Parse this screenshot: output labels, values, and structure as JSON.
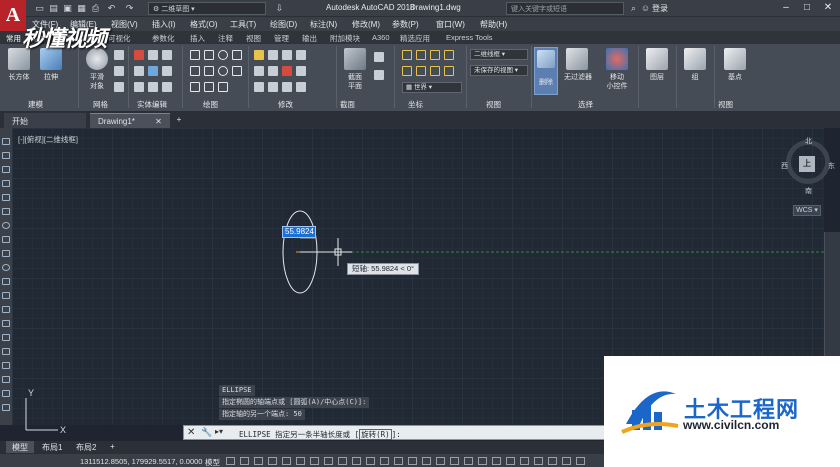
{
  "titlebar": {
    "workspace": "二维草图",
    "app_title": "Autodesk AutoCAD 2018",
    "file_name": "Drawing1.dwg",
    "search_placeholder": "键入关键字或短语",
    "login": "登录"
  },
  "menubar": {
    "items": [
      "文件(F)",
      "编辑(E)",
      "视图(V)",
      "插入(I)",
      "格式(O)",
      "工具(T)",
      "绘图(D)",
      "标注(N)",
      "修改(M)",
      "参数(P)",
      "窗口(W)",
      "帮助(H)",
      "Express"
    ]
  },
  "ribbon_tabs": [
    "常用",
    "实体",
    "曲面",
    "网格",
    "可视化",
    "参数化",
    "插入",
    "注释",
    "视图",
    "管理",
    "输出",
    "附加模块",
    "A360",
    "精选应用",
    "Express Tools"
  ],
  "ribbon": {
    "btn_box": "长方体",
    "btn_extrude": "拉伸",
    "btn_smooth": "平滑\n对象",
    "btn_section_plane": "截面\n平面",
    "btn_delete": "删除",
    "btn_no_filter": "无过滤器",
    "btn_gizmo": "移动\n小控件",
    "btn_layers": "图层",
    "btn_group": "组",
    "btn_base": "基点",
    "visual_style": "二维线框",
    "unsaved_view": "未保存的视图",
    "world": "世界",
    "panels": [
      "建模",
      "网格",
      "实体编辑",
      "绘图",
      "修改",
      "截面",
      "坐标",
      "视图",
      "选择",
      "视图"
    ]
  },
  "doc_tabs": {
    "start": "开始",
    "drawing": "Drawing1*"
  },
  "viewport": {
    "label": "[-][俯视][二维线框]",
    "dim_value": "55.9824",
    "tooltip": "短轴: 55.9824 < 0°"
  },
  "viewcube": {
    "north": "北",
    "south": "南",
    "east": "东",
    "west": "西",
    "face": "上",
    "wcs": "WCS"
  },
  "command": {
    "history": [
      "ELLIPSE",
      "指定椭圆的轴端点或 [圆弧(A)/中心点(C)]:",
      "指定轴的另一个端点: 50"
    ],
    "prompt_text": "ELLIPSE 指定另一条半轴长度或 [",
    "prompt_option": "旋转(R)",
    "prompt_end": "]:"
  },
  "layout_tabs": [
    "模型",
    "布局1",
    "布局2"
  ],
  "status": {
    "coords": "1311512.8505, 179929.5517, 0.0000",
    "model": "模型"
  },
  "watermark": {
    "top": "秒懂视频",
    "title": "土木工程网",
    "url": "www.civilcn.com"
  },
  "colors": {
    "app_red": "#b8232a",
    "accent_blue": "#1d6fd6",
    "watermark_blue": "#1b66c9"
  }
}
